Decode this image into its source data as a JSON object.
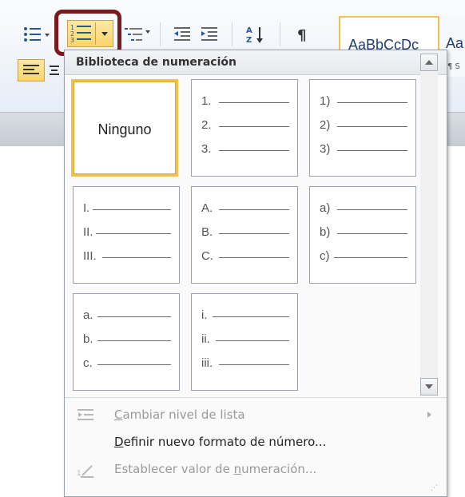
{
  "ribbon": {
    "style_preview_1": "AaBbCcDc",
    "style_preview_2": "Aa",
    "style_preview_2_sub": "¶ S"
  },
  "panel": {
    "header": "Biblioteca de numeración",
    "tiles": [
      {
        "label": "Ninguno",
        "selected": true,
        "markers": []
      },
      {
        "markers": [
          "1.",
          "2.",
          "3."
        ]
      },
      {
        "markers": [
          "1)",
          "2)",
          "3)"
        ]
      },
      {
        "markers": [
          "I.",
          "II.",
          "III."
        ]
      },
      {
        "markers": [
          "A.",
          "B.",
          "C."
        ]
      },
      {
        "markers": [
          "a)",
          "b)",
          "c)"
        ]
      },
      {
        "markers": [
          "a.",
          "b.",
          "c."
        ]
      },
      {
        "markers": [
          "i.",
          "ii.",
          "iii."
        ]
      }
    ],
    "menu": {
      "change_level_pre": "",
      "change_level_u": "C",
      "change_level_post": "ambiar nivel de lista",
      "define_u": "D",
      "define_post": "efinir nuevo formato de número...",
      "set_value_pre": "Establecer valor de ",
      "set_value_u": "n",
      "set_value_post": "umeración..."
    }
  },
  "colors": {
    "highlight_border": "#7a1a1f",
    "selected_tile": "#f1c24a",
    "active_button": "#fbd56b"
  }
}
